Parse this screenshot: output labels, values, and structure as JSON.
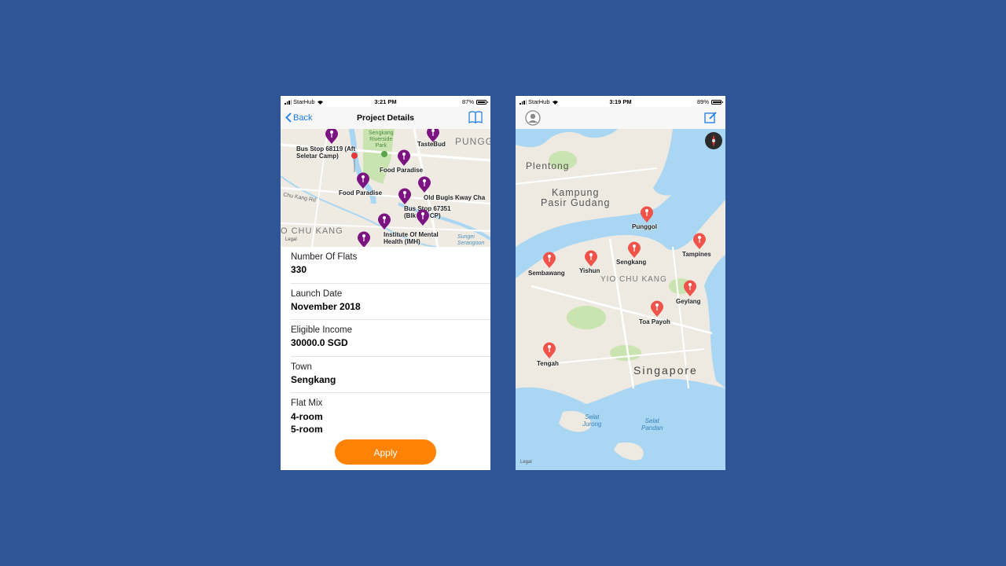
{
  "left_phone": {
    "status": {
      "carrier": "StarHub",
      "time": "3:21 PM",
      "battery": "87%"
    },
    "nav": {
      "back_label": "Back",
      "title": "Project Details"
    },
    "map": {
      "pins": [
        {
          "label": "Bus Stop 68119 (Aft\nSeletar Camp)"
        },
        {
          "label": "TasteBud"
        },
        {
          "label": "Food Paradise"
        },
        {
          "label": "Food Paradise"
        },
        {
          "label": "Old Bugis Kway Cha"
        },
        {
          "label": "Bus Stop 67351\n(Blk 174 CP)"
        },
        {
          "label": "Institute Of Mental\nHealth (IMH)"
        }
      ],
      "place_labels": {
        "park": "Sengkang\nRiverside\nPark",
        "punggol": "PUNGG",
        "chu_kang_rd": "Chu Kang Rd",
        "chu_kang": "O CHU KANG",
        "sungei": "Sungei\nSerangoon",
        "legal": "Legal"
      }
    },
    "details": [
      {
        "label": "Number Of Flats",
        "value": "330"
      },
      {
        "label": "Launch Date",
        "value": "November 2018"
      },
      {
        "label": "Eligible Income",
        "value": "30000.0 SGD"
      },
      {
        "label": "Town",
        "value": "Sengkang"
      },
      {
        "label": "Flat Mix",
        "value": "4-room\n5-room"
      }
    ],
    "apply_label": "Apply"
  },
  "right_phone": {
    "status": {
      "carrier": "StarHub",
      "time": "3:19 PM",
      "battery": "89%"
    },
    "map": {
      "places": {
        "plentong": "Plentong",
        "kampung": "Kampung\nPasir Gudang",
        "yio_chu_kang": "YIO CHU KANG",
        "singapore": "Singapore",
        "selat_jurong": "Selat\nJurong",
        "selat_pandan": "Selat\nPandan",
        "legal": "Legal"
      },
      "towns": [
        {
          "name": "Punggol"
        },
        {
          "name": "Tampines"
        },
        {
          "name": "Sembawang"
        },
        {
          "name": "Yishun"
        },
        {
          "name": "Sengkang"
        },
        {
          "name": "Geylang"
        },
        {
          "name": "Toa Payoh"
        },
        {
          "name": "Tengah"
        }
      ]
    }
  },
  "colors": {
    "background": "#2f5597",
    "accent": "#1a7ae6",
    "apply": "#ff8205",
    "pin_left": "#7b1480",
    "pin_right": "#f0534a",
    "water": "#a9d6f2",
    "park": "#c9e4b0"
  }
}
